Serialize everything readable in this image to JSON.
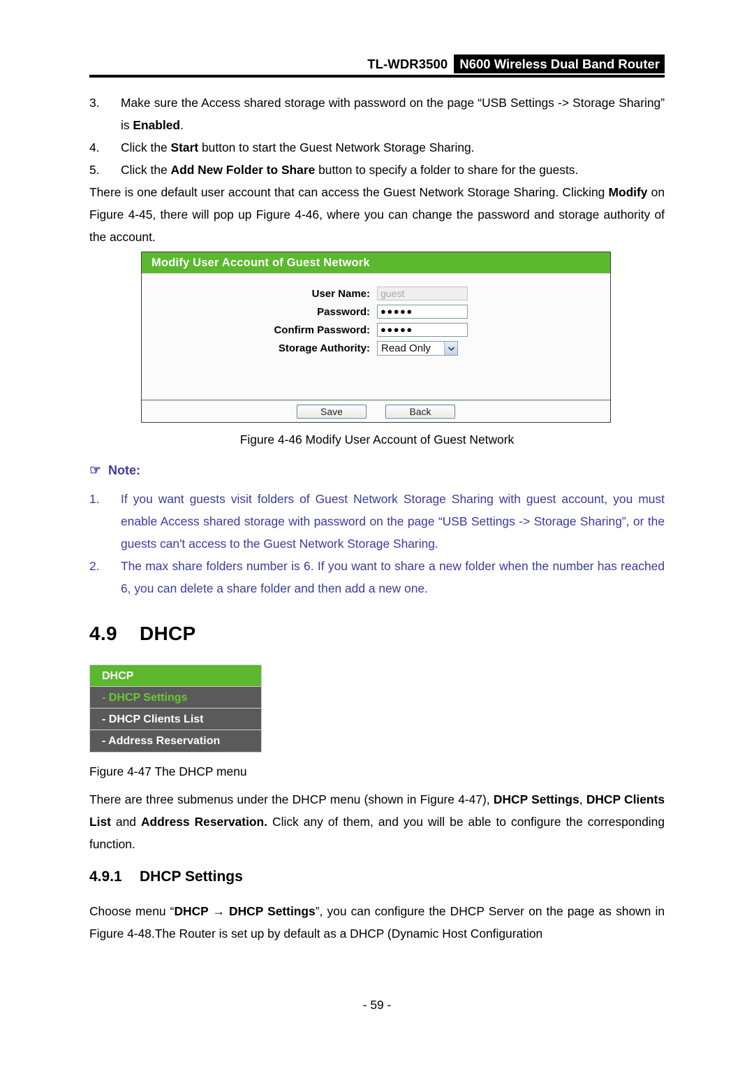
{
  "header": {
    "model": "TL-WDR3500",
    "product": "N600 Wireless Dual Band Router"
  },
  "steps": [
    {
      "num": "3.",
      "parts": [
        {
          "t": "Make sure the Access shared storage with password on the page “USB Settings -> Storage Sharing” is ",
          "b": false
        },
        {
          "t": "Enabled",
          "b": true
        },
        {
          "t": ".",
          "b": false
        }
      ]
    },
    {
      "num": "4.",
      "parts": [
        {
          "t": "Click the ",
          "b": false
        },
        {
          "t": "Start",
          "b": true
        },
        {
          "t": " button to start the Guest Network Storage Sharing.",
          "b": false
        }
      ]
    },
    {
      "num": "5.",
      "parts": [
        {
          "t": "Click the ",
          "b": false
        },
        {
          "t": "Add New Folder to Share",
          "b": true
        },
        {
          "t": " button to specify a folder to share for the guests.",
          "b": false
        }
      ]
    }
  ],
  "intro_paragraph": {
    "parts": [
      {
        "t": "There is one default user account that can access the Guest Network Storage Sharing. Clicking ",
        "b": false
      },
      {
        "t": "Modify",
        "b": true
      },
      {
        "t": " on Figure 4-45, there will pop up Figure 4-46, where you can change the password and storage authority of the account.",
        "b": false
      }
    ]
  },
  "modify_dialog": {
    "title": "Modify User Account of Guest Network",
    "fields": [
      {
        "label": "User Name:",
        "value": "guest",
        "type": "text",
        "disabled": true
      },
      {
        "label": "Password:",
        "value": "●●●●●",
        "type": "password",
        "disabled": false
      },
      {
        "label": "Confirm Password:",
        "value": "●●●●●",
        "type": "password",
        "disabled": false
      },
      {
        "label": "Storage Authority:",
        "value": "Read Only",
        "type": "select",
        "disabled": false
      }
    ],
    "buttons": {
      "save": "Save",
      "back": "Back"
    }
  },
  "figure_46_caption": "Figure 4-46 Modify User Account of Guest Network",
  "note": {
    "icon": "pointing-hand-icon",
    "icon_glyph": "☞",
    "heading": "Note:",
    "items": [
      {
        "num": "1.",
        "text": "If you want guests visit folders of Guest Network Storage Sharing with guest account, you must enable Access shared storage with password on the page “USB Settings -> Storage Sharing”, or the guests can't access to the Guest Network Storage Sharing."
      },
      {
        "num": "2.",
        "text": "The max share folders number is 6. If you want to share a new folder when the number has reached 6, you can delete a share folder and then add a new one."
      }
    ]
  },
  "section_49": {
    "num": "4.9",
    "title": "DHCP"
  },
  "dhcp_menu": {
    "header": "DHCP",
    "items": [
      {
        "label": "- DHCP Settings",
        "active": true
      },
      {
        "label": "- DHCP Clients List",
        "active": false
      },
      {
        "label": "- Address Reservation",
        "active": false
      }
    ]
  },
  "figure_47_caption": "Figure 4-47 The DHCP menu",
  "submenu_paragraph": {
    "parts": [
      {
        "t": "There are three submenus under the DHCP menu (shown in Figure 4-47), ",
        "b": false
      },
      {
        "t": "DHCP Settings",
        "b": true
      },
      {
        "t": ", ",
        "b": false
      },
      {
        "t": "DHCP Clients List",
        "b": true
      },
      {
        "t": " and ",
        "b": false
      },
      {
        "t": "Address Reservation.",
        "b": true
      },
      {
        "t": " Click any of them, and you will be able to configure the corresponding function.",
        "b": false
      }
    ]
  },
  "section_491": {
    "num": "4.9.1",
    "title": "DHCP Settings"
  },
  "dhcp_settings_paragraph": {
    "parts": [
      {
        "t": "Choose menu “",
        "b": false
      },
      {
        "t": "DHCP",
        "b": true
      },
      {
        "t": " → ",
        "b": true
      },
      {
        "t": "DHCP Settings",
        "b": true
      },
      {
        "t": "”, you can configure the DHCP Server on the page as shown in Figure 4-48.The Router is set up by default as a DHCP (Dynamic Host Configuration",
        "b": false
      }
    ]
  },
  "page_number": "- 59 -",
  "colors": {
    "accent_green": "#5cb82e",
    "menu_item_bg": "#5a5a5a",
    "menu_active_text": "#66cc33",
    "note_blue": "#3b3b9e",
    "header_black": "#000000"
  }
}
